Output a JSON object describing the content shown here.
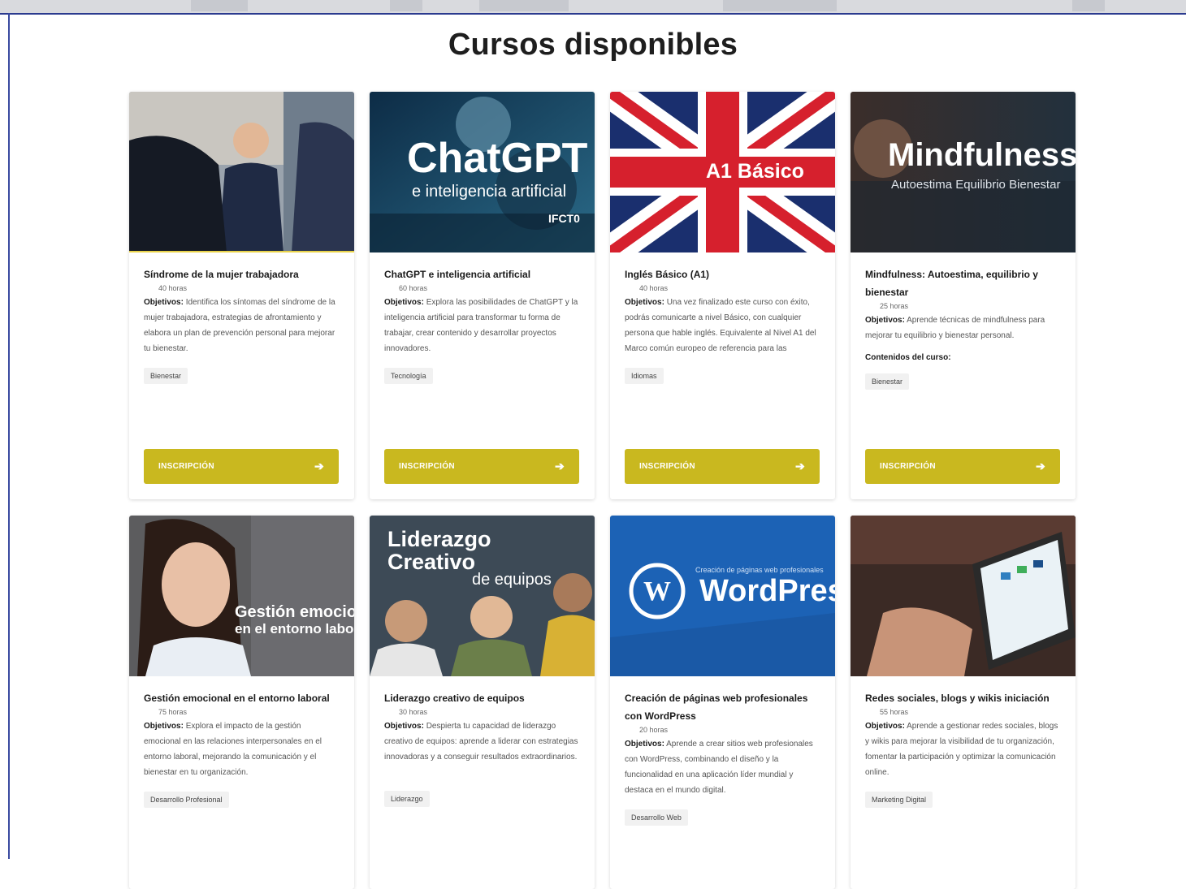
{
  "page": {
    "title": "Cursos disponibles"
  },
  "button_label": "INSCRIPCIÓN",
  "courses": [
    {
      "title": "Síndrome de la mujer trabajadora",
      "hours": "40 horas",
      "objectives_label": "Objetivos:",
      "objectives": "Identifica los síntomas del síndrome de la mujer trabajadora, estrategias de afrontamiento y elabora un plan de prevención personal para mejorar tu bienestar.",
      "tag": "Bienestar"
    },
    {
      "title": "ChatGPT e inteligencia artificial",
      "hours": "60 horas",
      "objectives_label": "Objetivos:",
      "objectives": "Explora las posibilidades de ChatGPT y la inteligencia artificial para transformar tu forma de trabajar, crear contenido y desarrollar proyectos innovadores.",
      "tag": "Tecnología",
      "image_text": {
        "main": "ChatGPT",
        "sub": "e inteligencia artificial",
        "code": "IFCT0"
      }
    },
    {
      "title": "Inglés Básico (A1)",
      "hours": "40 horas",
      "objectives_label": "Objetivos:",
      "objectives": "Una vez finalizado este curso con éxito, podrás comunicarte a nivel Básico, con cualquier persona que hable inglés. Equivalente al Nivel A1 del Marco común europeo de referencia para las",
      "tag": "Idiomas",
      "image_text": {
        "main": "A1 Básico"
      }
    },
    {
      "title": "Mindfulness: Autoestima, equilibrio y bienestar",
      "hours": "25 horas",
      "objectives_label": "Objetivos:",
      "objectives": "Aprende técnicas de mindfulness para mejorar tu equilibrio y bienestar personal.",
      "contents_label": "Contenidos del curso:",
      "tag": "Bienestar",
      "image_text": {
        "main": "Mindfulness",
        "sub": "Autoestima   Equilibrio   Bienestar"
      }
    },
    {
      "title": "Gestión emocional en el entorno laboral",
      "hours": "75 horas",
      "objectives_label": "Objetivos:",
      "objectives": "Explora el impacto de la gestión emocional en las relaciones interpersonales en el entorno laboral, mejorando la comunicación y el bienestar en tu organización.",
      "tag": "Desarrollo Profesional",
      "image_text": {
        "main": "Gestión emocional",
        "sub": "en el entorno laboral"
      }
    },
    {
      "title": "Liderazgo creativo de equipos",
      "hours": "30 horas",
      "objectives_label": "Objetivos:",
      "objectives": "Despierta tu capacidad de liderazgo creativo de equipos: aprende a liderar con estrategias innovadoras y a conseguir resultados extraordinarios.",
      "tag": "Liderazgo",
      "image_text": {
        "main": "Liderazgo",
        "main2": "Creativo",
        "sub": "de equipos"
      }
    },
    {
      "title": "Creación de páginas web profesionales con WordPress",
      "hours": "20 horas",
      "objectives_label": "Objetivos:",
      "objectives": "Aprende a crear sitios web profesionales con WordPress, combinando el diseño y la funcionalidad en una aplicación líder mundial y destaca en el mundo digital.",
      "tag": "Desarrollo Web",
      "image_text": {
        "main": "WordPress",
        "sub": "Creación de páginas web profesionales"
      }
    },
    {
      "title": "Redes sociales, blogs y wikis iniciación",
      "hours": "55 horas",
      "objectives_label": "Objetivos:",
      "objectives": "Aprende a gestionar redes sociales, blogs y wikis para mejorar la visibilidad de tu organización, fomentar la participación y optimizar la comunicación online.",
      "tag": "Marketing Digital"
    }
  ]
}
